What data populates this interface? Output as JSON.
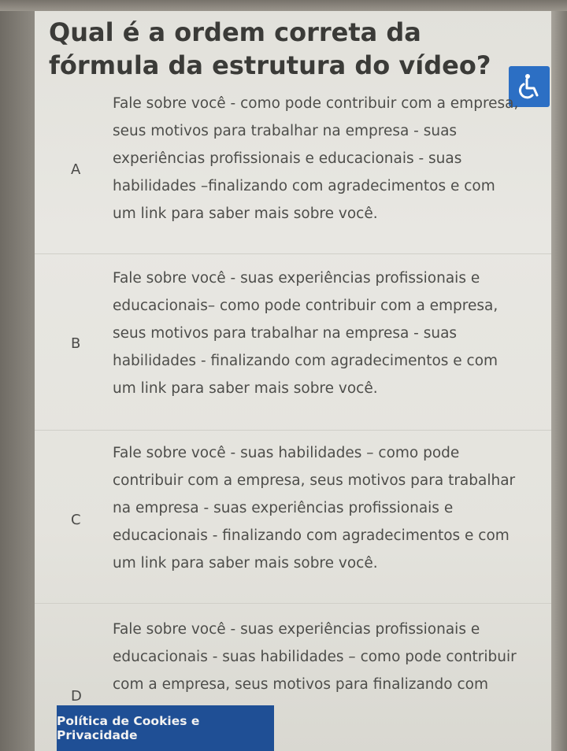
{
  "question": {
    "title": "Qual é a ordem correta da fórmula da estrutura do vídeo?"
  },
  "accessibility": {
    "icon": "wheelchair-icon",
    "color": "#2c6fc4"
  },
  "options": [
    {
      "letter": "A",
      "text": "Fale sobre você - como pode contribuir com a empresa, seus motivos para trabalhar na empresa - suas experiências profissionais e educacionais - suas habilidades –finalizando com agradecimentos e com um link para saber mais sobre você."
    },
    {
      "letter": "B",
      "text": "Fale sobre você - suas experiências profissionais e educacionais– como pode contribuir com a empresa, seus motivos para trabalhar na empresa - suas habilidades - finalizando com agradecimentos e com um link para saber mais sobre você."
    },
    {
      "letter": "C",
      "text": "Fale sobre você - suas habilidades – como pode contribuir com a empresa, seus motivos para trabalhar na empresa - suas experiências profissionais e educacionais - finalizando com agradecimentos e com um link para saber mais sobre você."
    },
    {
      "letter": "D",
      "text": "Fale sobre você - suas experiências profissionais e educacionais - suas habilidades – como pode contribuir com a empresa, seus motivos para finalizando com"
    }
  ],
  "cookie_banner": {
    "label": "Política de Cookies e Privacidade",
    "color": "#1f4f95"
  }
}
